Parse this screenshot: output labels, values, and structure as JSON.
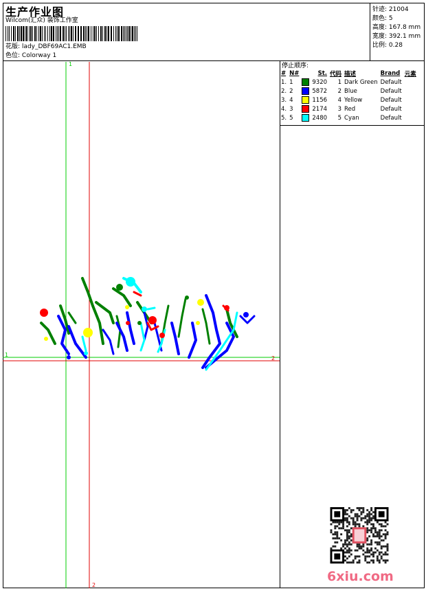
{
  "header": {
    "title": "生产作业图",
    "company": "Wilcom(汇众) 装饰工作室",
    "design_label": "花版:",
    "design_value": "lady_DBF69AC1.EMB",
    "colorway_label": "色位:",
    "colorway_value": "Colorway 1"
  },
  "info": [
    {
      "label": "针迹:",
      "value": "21004"
    },
    {
      "label": "颜色:",
      "value": "5"
    },
    {
      "label": "高度:",
      "value": "167.8 mm"
    },
    {
      "label": "宽度:",
      "value": "392.1 mm"
    },
    {
      "label": "比例:",
      "value": "0.28"
    }
  ],
  "stop_sequence": {
    "title": "停止顺序:",
    "headers": [
      "#",
      "N#",
      "St.",
      "代码",
      "描述",
      "Brand",
      "元素"
    ],
    "rows": [
      {
        "idx": "1.",
        "n": "1",
        "color": "#008000",
        "st": "9320",
        "code": "1",
        "desc": "Dark Green",
        "brand": "Default"
      },
      {
        "idx": "2.",
        "n": "2",
        "color": "#0000ff",
        "st": "5872",
        "code": "2",
        "desc": "Blue",
        "brand": "Default"
      },
      {
        "idx": "3.",
        "n": "4",
        "color": "#ffff00",
        "st": "1156",
        "code": "4",
        "desc": "Yellow",
        "brand": "Default"
      },
      {
        "idx": "4.",
        "n": "3",
        "color": "#ff0000",
        "st": "2174",
        "code": "3",
        "desc": "Red",
        "brand": "Default"
      },
      {
        "idx": "5.",
        "n": "5",
        "color": "#00ffff",
        "st": "2480",
        "code": "5",
        "desc": "Cyan",
        "brand": "Default"
      }
    ]
  },
  "guides": {
    "green_top": "1",
    "green_left": "1",
    "red_right": "2",
    "red_bottom": "2"
  },
  "watermark": "6xiu.com",
  "colors": {
    "dark_green": "#008000",
    "blue": "#0000ff",
    "yellow": "#ffff00",
    "red": "#ff0000",
    "cyan": "#00ffff",
    "guide_green": "#00cc00",
    "guide_red": "#e00000",
    "watermark": "#f06a84"
  }
}
